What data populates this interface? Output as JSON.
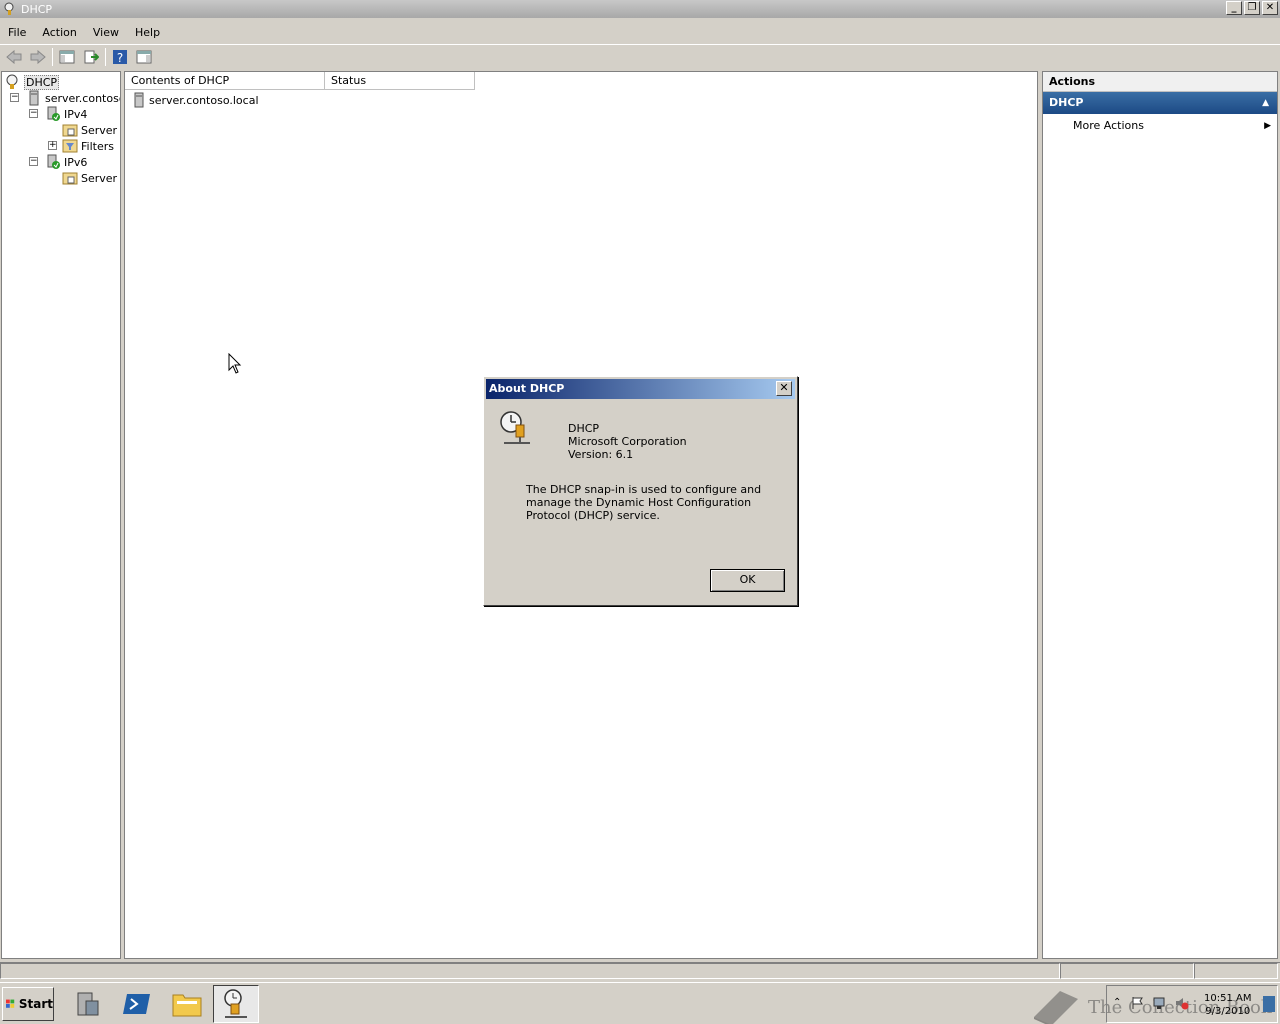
{
  "window": {
    "title": "DHCP"
  },
  "menu": [
    "File",
    "Action",
    "View",
    "Help"
  ],
  "tree": {
    "root": "DHCP",
    "server": "server.contoso",
    "ipv4": "IPv4",
    "ipv4_server_options": "Server",
    "filters": "Filters",
    "ipv6": "IPv6",
    "ipv6_server_options": "Server"
  },
  "content": {
    "columns": [
      "Contents of DHCP",
      "Status"
    ],
    "items": [
      {
        "name": "server.contoso.local",
        "status": ""
      }
    ]
  },
  "actions": {
    "title": "Actions",
    "section": "DHCP",
    "items": [
      "More Actions"
    ]
  },
  "dialog": {
    "title": "About DHCP",
    "close_label": "✕",
    "product": "DHCP",
    "company": "Microsoft Corporation",
    "version": "Version: 6.1",
    "description": "The DHCP snap-in is used to configure and manage the Dynamic Host Configuration Protocol (DHCP) service.",
    "ok_label": "OK"
  },
  "taskbar": {
    "start_label": "Start",
    "time": "10:51 AM",
    "date": "9/3/2010",
    "watermark": "The Collection Book"
  },
  "colors": {
    "dialog_title_start": "#0a246a",
    "dialog_title_end": "#a6caf0",
    "actions_section": "#1c4a85"
  }
}
